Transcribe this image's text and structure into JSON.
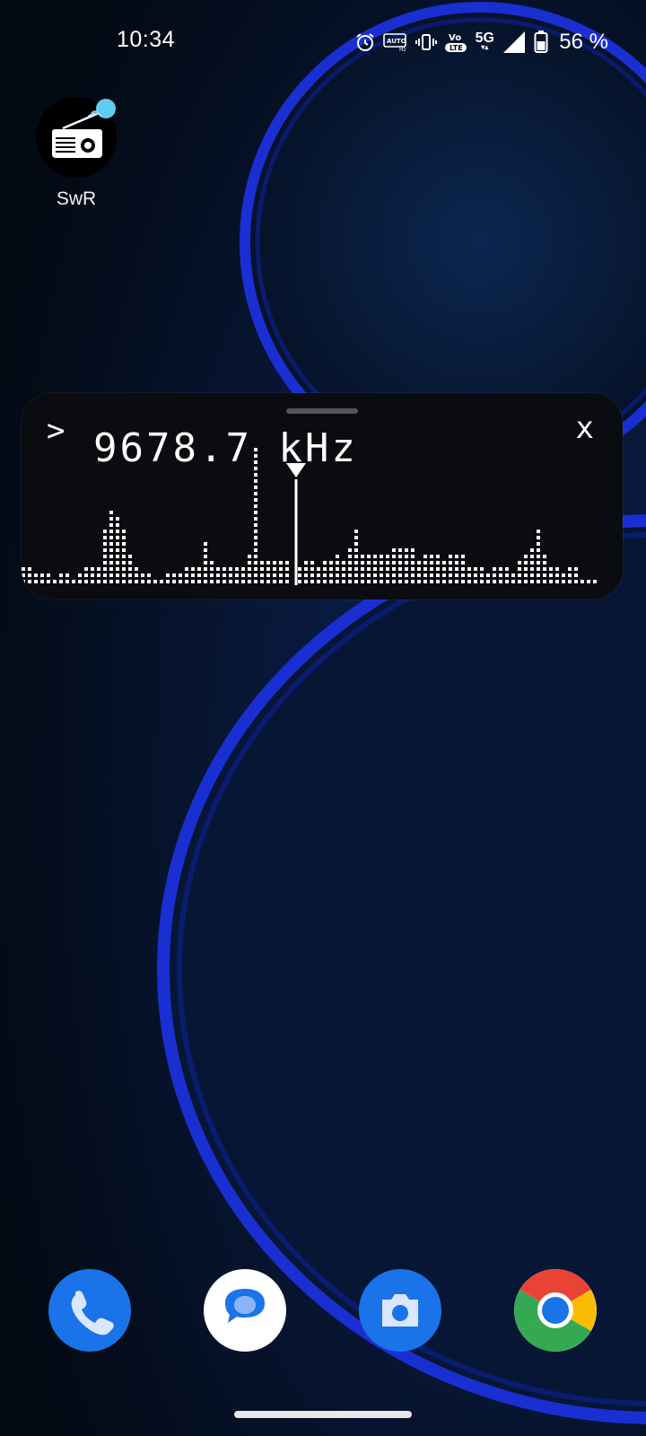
{
  "status_bar": {
    "time": "10:34",
    "network": "5G",
    "battery_percent": "56 %",
    "icons": [
      "alarm-icon",
      "auto-hz-icon",
      "vibrate-icon",
      "volte-icon",
      "signal-icon",
      "battery-icon"
    ]
  },
  "home": {
    "apps": [
      {
        "label": "SwR",
        "icon": "radio-icon"
      }
    ]
  },
  "widget": {
    "expand_glyph": ">",
    "close_glyph": "x",
    "frequency": "9678.7 kHz",
    "spectrum_levels": [
      3,
      3,
      2,
      2,
      2,
      1,
      2,
      2,
      1,
      2,
      3,
      3,
      3,
      9,
      12,
      11,
      9,
      5,
      3,
      2,
      2,
      1,
      1,
      2,
      2,
      2,
      3,
      3,
      3,
      7,
      4,
      3,
      3,
      3,
      3,
      3,
      5,
      12,
      4,
      4,
      4,
      4,
      4,
      0,
      3,
      4,
      4,
      3,
      4,
      4,
      5,
      4,
      6,
      9,
      5,
      5,
      5,
      5,
      5,
      6,
      6,
      6,
      6,
      4,
      5,
      5,
      5,
      4,
      5,
      5,
      5,
      3,
      3,
      3,
      2,
      3,
      3,
      3,
      2,
      4,
      5,
      6,
      9,
      5,
      3,
      3,
      2,
      3,
      3,
      1,
      1,
      1,
      0
    ],
    "spectrum_peaks": [
      0,
      0,
      0,
      0,
      0,
      0,
      0,
      0,
      0,
      0,
      0,
      0,
      0,
      0,
      0,
      0,
      0,
      0,
      0,
      0,
      0,
      0,
      0,
      0,
      0,
      0,
      0,
      0,
      0,
      0,
      0,
      0,
      0,
      0,
      0,
      0,
      0,
      22,
      0,
      0,
      0,
      0,
      0,
      0,
      0,
      0,
      0,
      0,
      0,
      0,
      0,
      0,
      0,
      0,
      0,
      0,
      0,
      0,
      0,
      0,
      0,
      0,
      0,
      0,
      0,
      0,
      0,
      0,
      0,
      0,
      0,
      0,
      0,
      0,
      0,
      0,
      0,
      0,
      0,
      0,
      0,
      0,
      0,
      0,
      0,
      0,
      0,
      0,
      0,
      0,
      0,
      0,
      0
    ],
    "tuner_marker_index": 43
  },
  "dock": [
    {
      "app": "phone",
      "icon": "phone-icon",
      "color": "#1a73e8"
    },
    {
      "app": "messages",
      "icon": "messages-icon",
      "color": "#1a73e8"
    },
    {
      "app": "camera",
      "icon": "camera-icon",
      "color": "#1a73e8"
    },
    {
      "app": "chrome",
      "icon": "chrome-icon",
      "color": "#1a73e8"
    }
  ],
  "colors": {
    "accent_blue": "#1a73e8",
    "wallpaper_ring": "#1f33d8",
    "app_badge": "#5ecbf0"
  }
}
